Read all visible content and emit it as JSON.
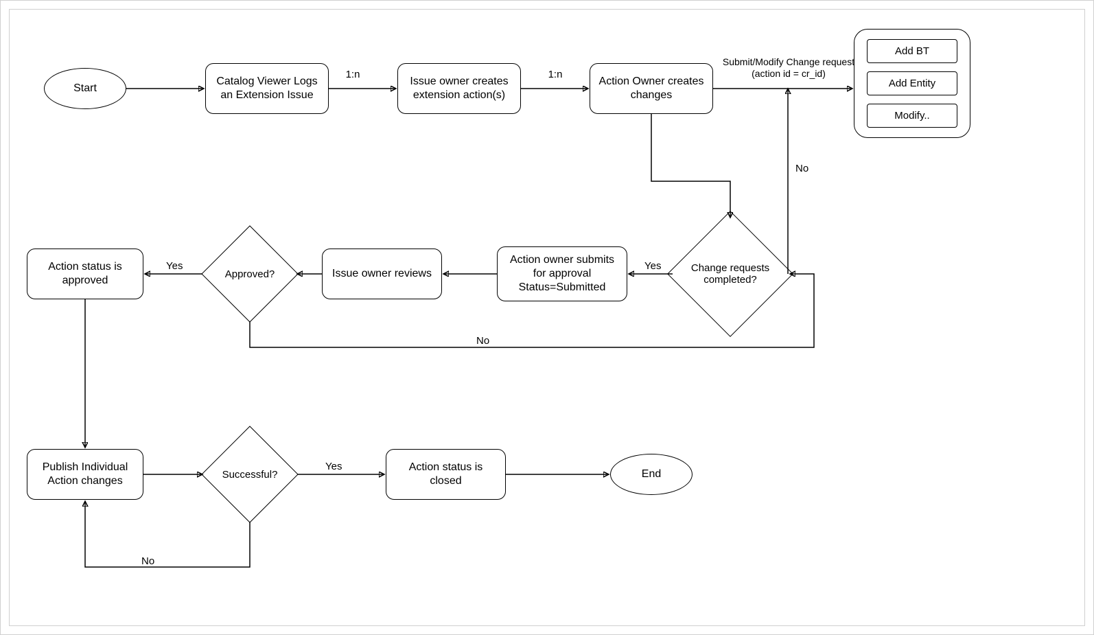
{
  "nodes": {
    "start": "Start",
    "catalog": "Catalog Viewer Logs an Extension Issue",
    "issueCreates": "Issue owner creates extension action(s)",
    "actionOwner": "Action Owner creates changes",
    "submitLabel": "Submit/Modify Change request\n(action id  = cr_id)",
    "container": {
      "addBT": "Add BT",
      "addEntity": "Add Entity",
      "modify": "Modify.."
    },
    "changeReqDecision": "Change requests completed?",
    "actionSubmit": "Action owner submits for approval Status=Submitted",
    "issueReview": "Issue owner  reviews",
    "approvedDecision": "Approved?",
    "approvedStatus": "Action status is approved",
    "publish": "Publish Individual Action changes",
    "successDecision": "Successful?",
    "closed": "Action status is closed",
    "end": "End"
  },
  "edges": {
    "one_n_1": "1:n",
    "one_n_2": "1:n",
    "no1": "No",
    "yes1": "Yes",
    "yes2": "Yes",
    "no2": "No",
    "yes3": "Yes",
    "no3": "No"
  }
}
